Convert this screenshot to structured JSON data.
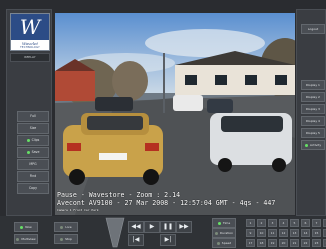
{
  "logo": {
    "letter": "W",
    "brand": "Wavelet",
    "subbrand": "TECHNOLOGY"
  },
  "left_panel": {
    "label": "REPLAY",
    "buttons": [
      {
        "label": "Full",
        "led": false
      },
      {
        "label": "Size",
        "led": false
      },
      {
        "label": "Clips",
        "led": true
      },
      {
        "label": "Save",
        "led": true
      },
      {
        "label": "MPG",
        "led": false
      },
      {
        "label": "Find",
        "led": false
      },
      {
        "label": "Copy",
        "led": false
      }
    ]
  },
  "video": {
    "overlay_line1": "Pause - Wavestore - Zoom : 2.14",
    "overlay_line2": "Avecont AV9100 - 27 Mar 2008 - 12:57:04 GMT - 4qs - 447",
    "overlay_small": "Camera 1 Front Car Park"
  },
  "right_panel": {
    "top_button": "Logout",
    "buttons": [
      "Display 1",
      "Display 2",
      "Display 3",
      "Display 4",
      "Display 5",
      "Activity"
    ]
  },
  "bottom": {
    "left_buttons": [
      {
        "label": "Now",
        "led": true
      },
      {
        "label": "Live",
        "led": false
      },
      {
        "label": "Multiview",
        "led": false
      },
      {
        "label": "Stop",
        "led": false
      }
    ],
    "transport": {
      "rewind": "◀◀",
      "play": "▶",
      "pause": "❚❚",
      "ffwd": "▶▶",
      "step_back": "|◀",
      "step_fwd": "▶|"
    },
    "right_buttons": [
      {
        "label": "Time",
        "led": true
      },
      {
        "label": "Duration",
        "led": false
      },
      {
        "label": "Speed",
        "led": false
      }
    ],
    "numpad": [
      "1",
      "2",
      "3",
      "4",
      "5",
      "6",
      "7",
      "8",
      "9",
      "10",
      "11",
      "12",
      "13",
      "14",
      "15",
      "16",
      "17",
      "18",
      "19",
      "20",
      "21",
      "22",
      "23",
      "24"
    ]
  }
}
